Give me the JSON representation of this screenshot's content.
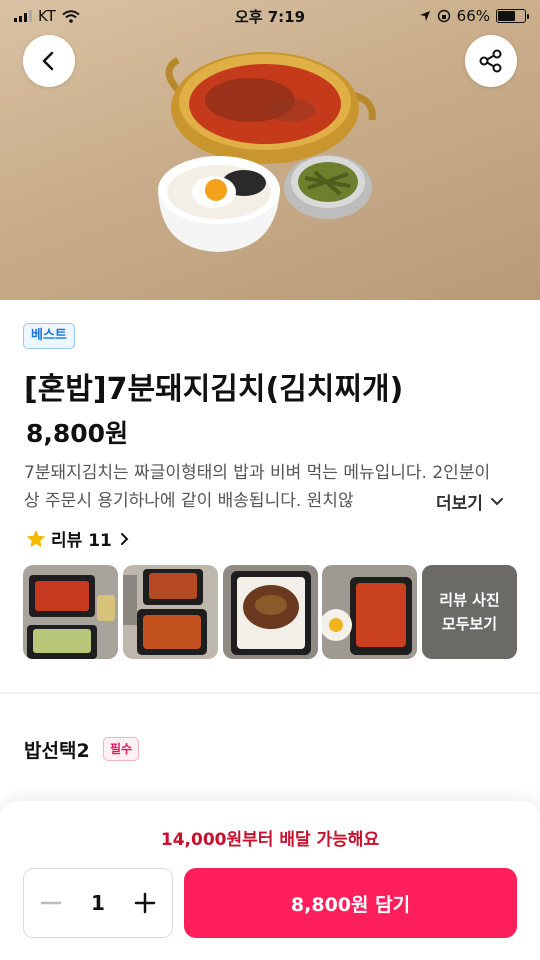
{
  "status_bar": {
    "carrier": "KT",
    "time": "오후 7:19",
    "battery": "66%",
    "battery_level": 0.66
  },
  "menu": {
    "badge": "베스트",
    "title": "[혼밥]7분돼지김치(김치찌개)",
    "price": "8,800원",
    "description": "7분돼지김치는 짜글이형태의 밥과 비벼 먹는 메뉴입니다. 2인분이상 주문시 용기하나에 같이 배송됩니다. 원치않",
    "more_label": "더보기"
  },
  "reviews": {
    "label": "리뷰 11",
    "see_all_label": "리뷰 사진\n모두보기"
  },
  "option": {
    "title": "밥선택2",
    "required_badge": "필수"
  },
  "bottom": {
    "min_order_notice": "14,000원부터 배달 가능해요",
    "quantity": "1",
    "add_button": "8,800원 담기"
  },
  "colors": {
    "accent": "#ff1f5a",
    "notice": "#c8102e",
    "best_badge": "#1a73d9",
    "required_badge": "#e8175d",
    "star": "#f5b800"
  },
  "icons": [
    "back-arrow-icon",
    "share-icon",
    "chevron-down-icon",
    "star-icon",
    "chevron-right-icon",
    "minus-icon",
    "plus-icon"
  ]
}
